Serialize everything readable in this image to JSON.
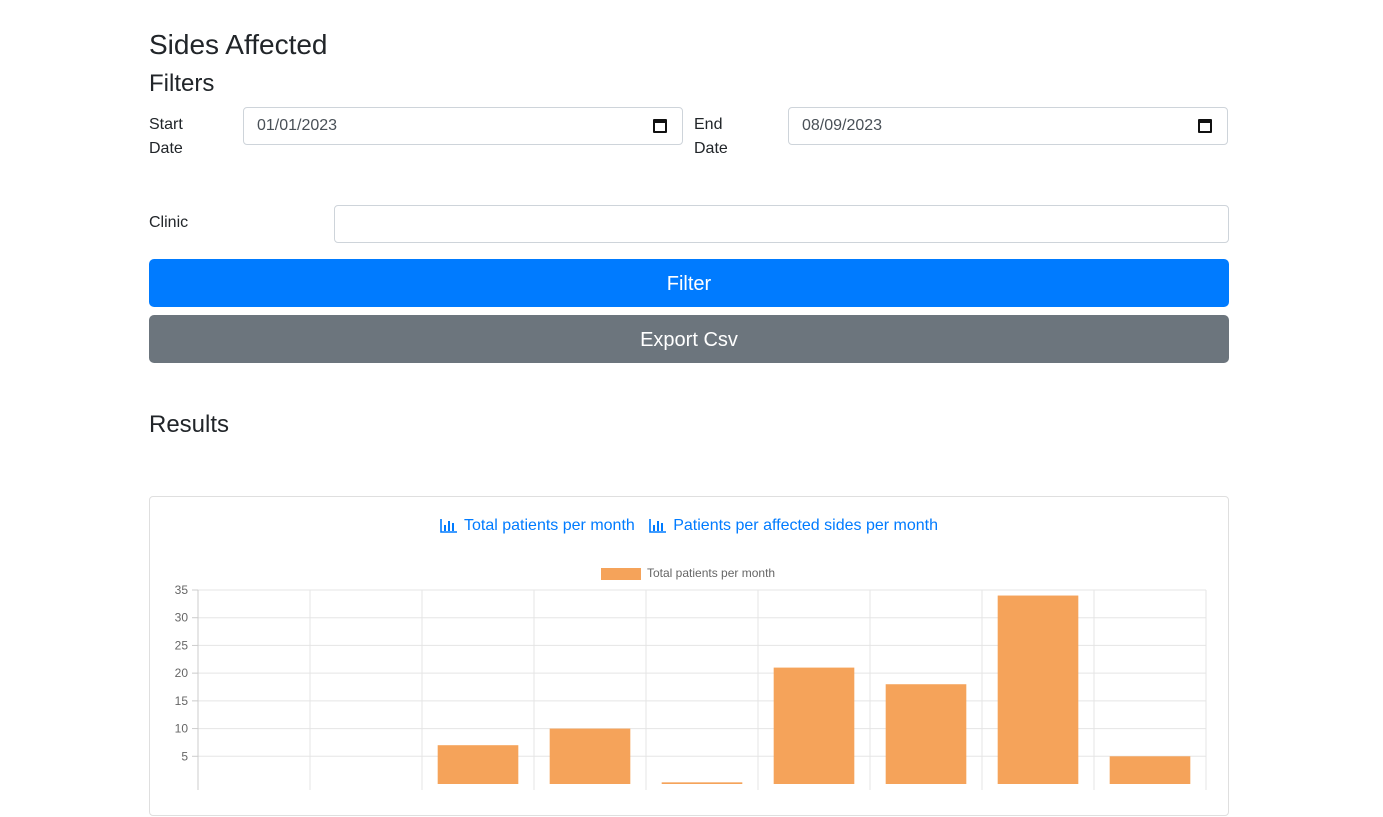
{
  "page": {
    "title": "Sides Affected",
    "filters_title": "Filters",
    "start_date_label_1": "Start",
    "start_date_label_2": "Date",
    "start_date_value": "01/01/2023",
    "end_date_label_1": "End",
    "end_date_label_2": "Date",
    "end_date_value": "08/09/2023",
    "clinic_label": "Clinic",
    "clinic_value": "",
    "filter_button": "Filter",
    "export_button": "Export Csv",
    "results_title": "Results"
  },
  "tabs": [
    {
      "label": "Total patients per month",
      "icon": "bar-chart-icon"
    },
    {
      "label": "Patients per affected sides per month",
      "icon": "bar-chart-icon"
    }
  ],
  "colors": {
    "primary": "#007bff",
    "secondary": "#6c757d",
    "bar": "#f5a35a"
  },
  "chart_data": {
    "type": "bar",
    "legend": "Total patients per month",
    "legend_position": "top",
    "categories": [
      "",
      "",
      "",
      "",
      "",
      "",
      "",
      "",
      ""
    ],
    "values": [
      0,
      0,
      7,
      10,
      0.3,
      21,
      18,
      34,
      5
    ],
    "y_ticks": [
      35,
      30,
      25,
      20,
      15,
      10,
      5
    ],
    "ylim": [
      0,
      35
    ],
    "grid": true
  }
}
